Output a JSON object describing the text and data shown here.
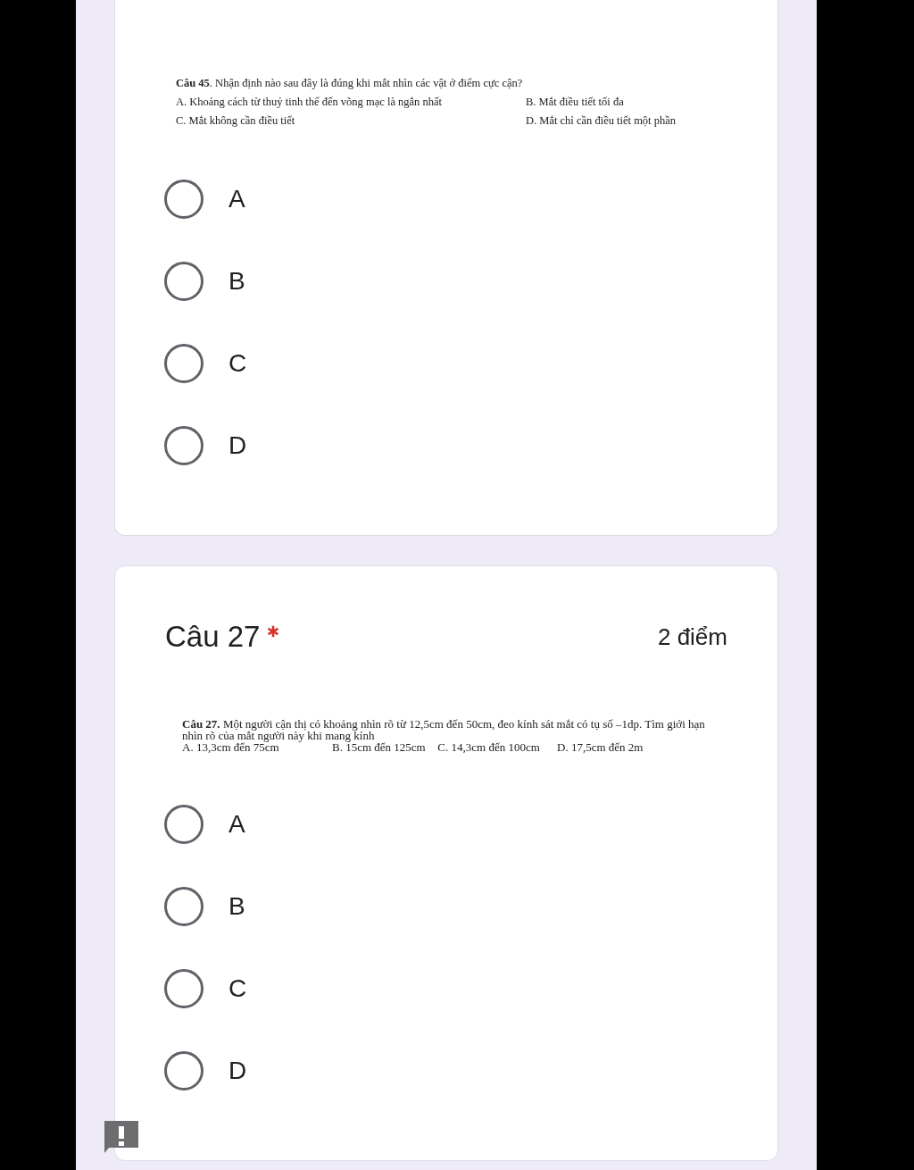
{
  "questions": [
    {
      "body": "**Câu 45**. Nhận định nào sau đây là đúng khi mắt nhìn các vật ở điểm cực cận?",
      "kind": "grid",
      "options": [
        "A. Khoảng cách từ thuỷ tinh thể đến võng mạc là ngắn nhất",
        "B. Mắt điều tiết tối đa",
        "C. Mắt không cần điều tiết",
        "D. Mắt chỉ cần điều tiết một phần"
      ],
      "choices": [
        {
          "label": "A",
          "selected": false
        },
        {
          "label": "B",
          "selected": false
        },
        {
          "label": "C",
          "selected": false
        },
        {
          "label": "D",
          "selected": false
        }
      ]
    },
    {
      "title": "Câu 27",
      "required": true,
      "points": "2 điểm",
      "body": "**Câu 27.** Một người cận thị có khoảng nhìn rõ từ 12,5cm đến 50cm, đeo kính sát mắt có tụ số –1dp. Tìm giới hạn nhìn rõ của mắt người này khi mang kính",
      "kind": "row",
      "options": [
        "A. 13,3cm đến 75cm",
        "B. 15cm đến 125cm",
        "C. 14,3cm đến 100cm",
        "D. 17,5cm đến 2m"
      ],
      "choices": [
        {
          "label": "A",
          "selected": false
        },
        {
          "label": "B",
          "selected": false
        },
        {
          "label": "C",
          "selected": false
        },
        {
          "label": "D",
          "selected": false
        }
      ]
    }
  ]
}
